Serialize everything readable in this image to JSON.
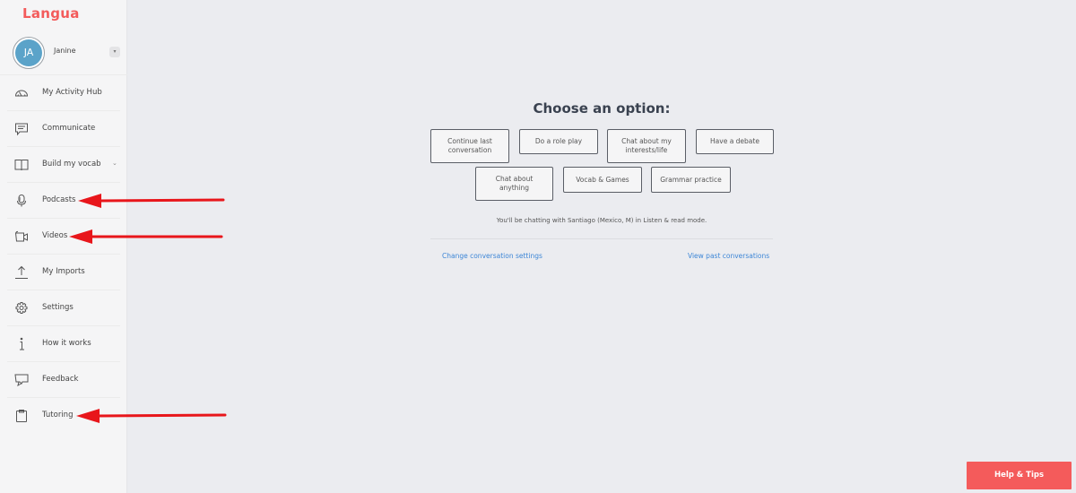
{
  "app": {
    "logo": "Langua"
  },
  "user": {
    "initials": "JA",
    "name": "Janine",
    "toggle_icon": "chevron-down-icon"
  },
  "sidebar": {
    "items": [
      {
        "label": "My Activity Hub",
        "icon": "gauge-icon"
      },
      {
        "label": "Communicate",
        "icon": "chat-bubble-icon"
      },
      {
        "label": "Build my vocab",
        "icon": "book-icon",
        "has_submenu": true,
        "chevron": "⌄"
      },
      {
        "label": "Podcasts",
        "icon": "microphone-icon"
      },
      {
        "label": "Videos",
        "icon": "video-camera-icon"
      },
      {
        "label": "My Imports",
        "icon": "upload-icon"
      },
      {
        "label": "Settings",
        "icon": "gear-icon"
      },
      {
        "label": "How it works",
        "icon": "info-icon"
      },
      {
        "label": "Feedback",
        "icon": "feedback-icon"
      },
      {
        "label": "Tutoring",
        "icon": "clipboard-icon"
      }
    ]
  },
  "main": {
    "title": "Choose an option:",
    "options": [
      "Continue last conversation",
      "Do a role play",
      "Chat about my interests/life",
      "Have a debate",
      "Chat about anything",
      "Vocab & Games",
      "Grammar practice"
    ],
    "info": "You'll be chatting with Santiago (Mexico, M) in Listen & read mode.",
    "links": {
      "change_settings": "Change conversation settings",
      "past_conversations": "View past conversations"
    }
  },
  "help_button": "Help & Tips",
  "annotations": {
    "arrow_color": "#e8161b",
    "arrows_point_to": [
      "Podcasts",
      "Videos",
      "Tutoring"
    ]
  },
  "colors": {
    "brand": "#f35b5b",
    "link": "#3d86d6",
    "avatar": "#5ba3c9",
    "help_button": "#f45b5b"
  }
}
